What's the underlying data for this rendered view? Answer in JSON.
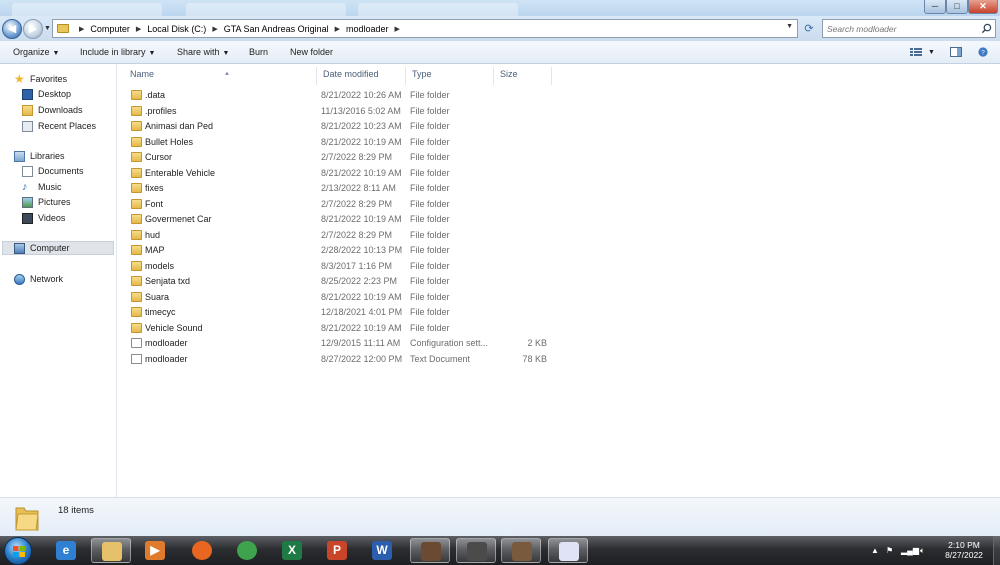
{
  "window": {
    "controls": {
      "minimize": "─",
      "maximize": "□",
      "close": "✕"
    }
  },
  "address": {
    "crumbs": [
      "Computer",
      "Local Disk (C:)",
      "GTA San Andreas Original",
      "modloader"
    ],
    "search_placeholder": "Search modloader"
  },
  "toolbar": {
    "organize": "Organize",
    "include_in_library": "Include in library",
    "share_with": "Share with",
    "burn": "Burn",
    "new_folder": "New folder"
  },
  "nav": {
    "favorites": "Favorites",
    "desktop": "Desktop",
    "downloads": "Downloads",
    "recent_places": "Recent Places",
    "libraries": "Libraries",
    "documents": "Documents",
    "music": "Music",
    "pictures": "Pictures",
    "videos": "Videos",
    "computer": "Computer",
    "network": "Network"
  },
  "columns": {
    "name": "Name",
    "date_modified": "Date modified",
    "type": "Type",
    "size": "Size"
  },
  "files": [
    {
      "name": ".data",
      "date": "8/21/2022 10:26 AM",
      "type": "File folder",
      "size": "",
      "icon": "folder-icon"
    },
    {
      "name": ".profiles",
      "date": "11/13/2016 5:02 AM",
      "type": "File folder",
      "size": "",
      "icon": "folder-icon"
    },
    {
      "name": "Animasi dan Ped",
      "date": "8/21/2022 10:23 AM",
      "type": "File folder",
      "size": "",
      "icon": "folder-icon"
    },
    {
      "name": "Bullet Holes",
      "date": "8/21/2022 10:19 AM",
      "type": "File folder",
      "size": "",
      "icon": "folder-icon"
    },
    {
      "name": "Cursor",
      "date": "2/7/2022 8:29 PM",
      "type": "File folder",
      "size": "",
      "icon": "folder-icon"
    },
    {
      "name": "Enterable Vehicle",
      "date": "8/21/2022 10:19 AM",
      "type": "File folder",
      "size": "",
      "icon": "folder-icon"
    },
    {
      "name": "fixes",
      "date": "2/13/2022 8:11 AM",
      "type": "File folder",
      "size": "",
      "icon": "folder-icon"
    },
    {
      "name": "Font",
      "date": "2/7/2022 8:29 PM",
      "type": "File folder",
      "size": "",
      "icon": "folder-icon"
    },
    {
      "name": "Govermenet Car",
      "date": "8/21/2022 10:19 AM",
      "type": "File folder",
      "size": "",
      "icon": "folder-icon"
    },
    {
      "name": "hud",
      "date": "2/7/2022 8:29 PM",
      "type": "File folder",
      "size": "",
      "icon": "folder-icon"
    },
    {
      "name": "MAP",
      "date": "2/28/2022 10:13 PM",
      "type": "File folder",
      "size": "",
      "icon": "folder-icon"
    },
    {
      "name": "models",
      "date": "8/3/2017 1:16 PM",
      "type": "File folder",
      "size": "",
      "icon": "folder-icon"
    },
    {
      "name": "Senjata txd",
      "date": "8/25/2022 2:23 PM",
      "type": "File folder",
      "size": "",
      "icon": "folder-icon"
    },
    {
      "name": "Suara",
      "date": "8/21/2022 10:19 AM",
      "type": "File folder",
      "size": "",
      "icon": "folder-icon"
    },
    {
      "name": "timecyc",
      "date": "12/18/2021 4:01 PM",
      "type": "File folder",
      "size": "",
      "icon": "folder-icon"
    },
    {
      "name": "Vehicle Sound",
      "date": "8/21/2022 10:19 AM",
      "type": "File folder",
      "size": "",
      "icon": "folder-icon"
    },
    {
      "name": "modloader",
      "date": "12/9/2015 11:11 AM",
      "type": "Configuration sett...",
      "size": "2 KB",
      "icon": "config-file-icon"
    },
    {
      "name": "modloader",
      "date": "8/27/2022 12:00 PM",
      "type": "Text Document",
      "size": "78 KB",
      "icon": "text-file-icon"
    }
  ],
  "details": {
    "count": "18 items"
  },
  "taskbar": {
    "apps": [
      {
        "id": "internet-explorer",
        "glyph": "e",
        "color": "#2f7fd3"
      },
      {
        "id": "file-explorer",
        "glyph": "",
        "color": "#e5c26a"
      },
      {
        "id": "media-player",
        "glyph": "▶",
        "color": "#e07a2d"
      },
      {
        "id": "firefox",
        "glyph": "",
        "color": "#e8661f"
      },
      {
        "id": "chrome",
        "glyph": "",
        "color": "#3fa34d"
      },
      {
        "id": "excel",
        "glyph": "X",
        "color": "#1f7a45"
      },
      {
        "id": "powerpoint",
        "glyph": "P",
        "color": "#c9452a"
      },
      {
        "id": "word",
        "glyph": "W",
        "color": "#2b5fad"
      },
      {
        "id": "gta-1",
        "glyph": "",
        "color": "#6b4a32"
      },
      {
        "id": "gta-2",
        "glyph": "",
        "color": "#4b4b4b"
      },
      {
        "id": "gta-3",
        "glyph": "",
        "color": "#7a5a3c"
      },
      {
        "id": "document-app",
        "glyph": "",
        "color": "#dfe3f5"
      }
    ],
    "time": "2:10 PM",
    "date": "8/27/2022"
  }
}
